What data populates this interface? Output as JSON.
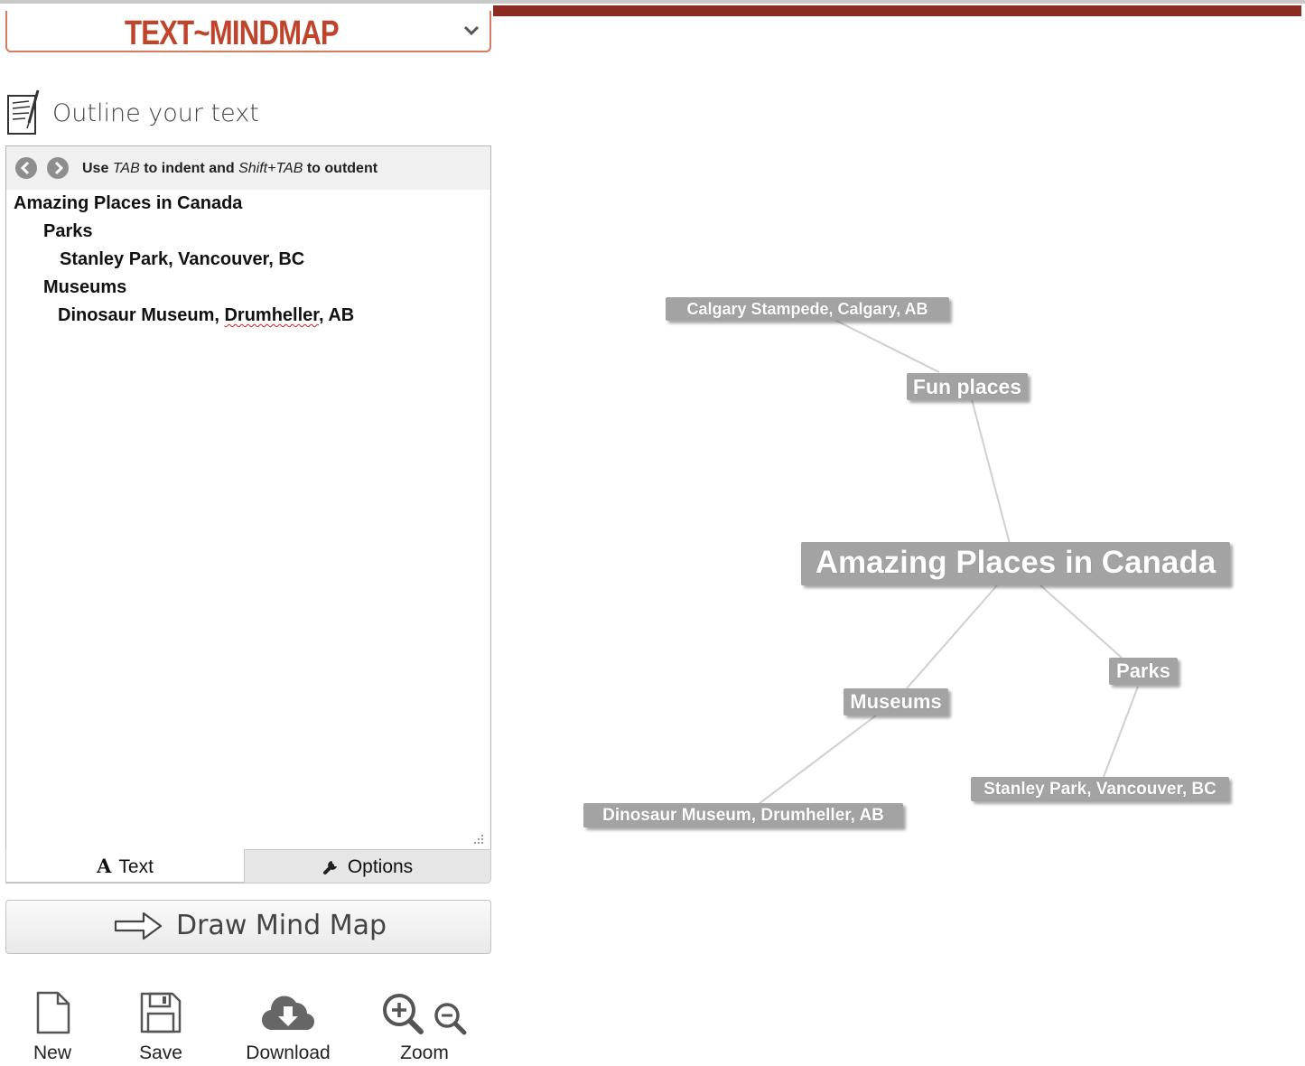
{
  "app": {
    "logo": "TEXT~MINDMAP"
  },
  "outline_panel": {
    "title": "Outline your text",
    "hint": {
      "use": "Use",
      "tab_key": "TAB",
      "to_indent": "to indent and",
      "shift_tab_key": "Shift+TAB",
      "to_outdent": "to outdent"
    },
    "lines": [
      {
        "text": "Amazing Places in Canada",
        "level": 0
      },
      {
        "text": "Parks",
        "level": 1
      },
      {
        "text": "Stanley Park, Vancouver, BC",
        "level": 2
      },
      {
        "text": "Museums",
        "level": 1
      },
      {
        "text": "Dinosaur Museum, Drumheller, AB",
        "level": 2
      }
    ],
    "line5_pre": "Dinosaur Museum, ",
    "line5_misspelled": "Drumheller",
    "line5_post": ", AB"
  },
  "tabs": {
    "text_label": "Text",
    "text_glyph": "A",
    "options_label": "Options"
  },
  "draw_button": {
    "label": "Draw Mind Map"
  },
  "toolbar": {
    "new_label": "New",
    "save_label": "Save",
    "download_label": "Download",
    "zoom_label": "Zoom"
  },
  "mindmap": {
    "root": "Amazing Places in Canada",
    "nodes": [
      {
        "id": "root",
        "text": "Amazing Places in Canada"
      },
      {
        "id": "fun",
        "text": "Fun places"
      },
      {
        "id": "calgary",
        "text": "Calgary Stampede, Calgary, AB"
      },
      {
        "id": "museums",
        "text": "Museums"
      },
      {
        "id": "dino",
        "text": "Dinosaur Museum, Drumheller, AB"
      },
      {
        "id": "parks",
        "text": "Parks"
      },
      {
        "id": "stanley",
        "text": "Stanley Park, Vancouver, BC"
      }
    ],
    "edges": [
      [
        "root",
        "fun"
      ],
      [
        "fun",
        "calgary"
      ],
      [
        "root",
        "museums"
      ],
      [
        "museums",
        "dino"
      ],
      [
        "root",
        "parks"
      ],
      [
        "parks",
        "stanley"
      ]
    ],
    "colors": {
      "node_fill": "#a3a3a3",
      "node_text": "#ffffff",
      "edge": "#cfcfcf"
    }
  },
  "colors": {
    "brand": "#c0442c",
    "top_bar": "#8b2b22"
  }
}
